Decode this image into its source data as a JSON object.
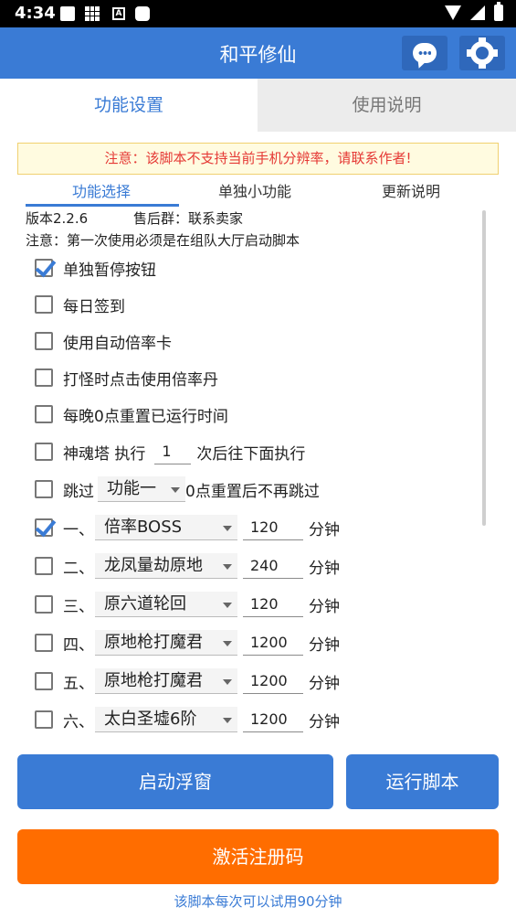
{
  "status_bar": {
    "time": "4:34",
    "badge": "A"
  },
  "app": {
    "title": "和平修仙"
  },
  "tabs": {
    "settings": "功能设置",
    "instructions": "使用说明"
  },
  "notice": "注意：该脚本不支持当前手机分辨率，请联系作者!",
  "subtabs": {
    "func_select": "功能选择",
    "single_func": "单独小功能",
    "update_notes": "更新说明"
  },
  "info": {
    "version": "版本2.2.6",
    "group": "售后群：联系卖家",
    "note": "注意：第一次使用必须是在组队大厅启动脚本"
  },
  "options": [
    {
      "label": "单独暂停按钮",
      "checked": true
    },
    {
      "label": "每日签到",
      "checked": false
    },
    {
      "label": "使用自动倍率卡",
      "checked": false
    },
    {
      "label": "打怪时点击使用倍率丹",
      "checked": false
    },
    {
      "label": "每晚0点重置已运行时间",
      "checked": false
    }
  ],
  "tower": {
    "label": "神魂塔 执行",
    "count": "1",
    "suffix": "次后往下面执行",
    "checked": false
  },
  "skip": {
    "label": "跳过",
    "select": "功能一",
    "suffix": "0点重置后不再跳过",
    "checked": false
  },
  "tasks": [
    {
      "index": "一、",
      "name": "倍率BOSS",
      "minutes": "120",
      "unit": "分钟",
      "checked": true
    },
    {
      "index": "二、",
      "name": "龙凤量劫原地",
      "minutes": "240",
      "unit": "分钟",
      "checked": false
    },
    {
      "index": "三、",
      "name": "原六道轮回",
      "minutes": "120",
      "unit": "分钟",
      "checked": false
    },
    {
      "index": "四、",
      "name": "原地枪打魔君",
      "minutes": "1200",
      "unit": "分钟",
      "checked": false
    },
    {
      "index": "五、",
      "name": "原地枪打魔君",
      "minutes": "1200",
      "unit": "分钟",
      "checked": false
    },
    {
      "index": "六、",
      "name": "太白圣墟6阶",
      "minutes": "1200",
      "unit": "分钟",
      "checked": false
    }
  ],
  "buttons": {
    "float_window": "启动浮窗",
    "run_script": "运行脚本",
    "activate": "激活注册码"
  },
  "footer": "该脚本每次可以试用90分钟",
  "colors": {
    "primary": "#3a7bd5",
    "accent": "#ff6d00",
    "warning_text": "#e53935"
  }
}
